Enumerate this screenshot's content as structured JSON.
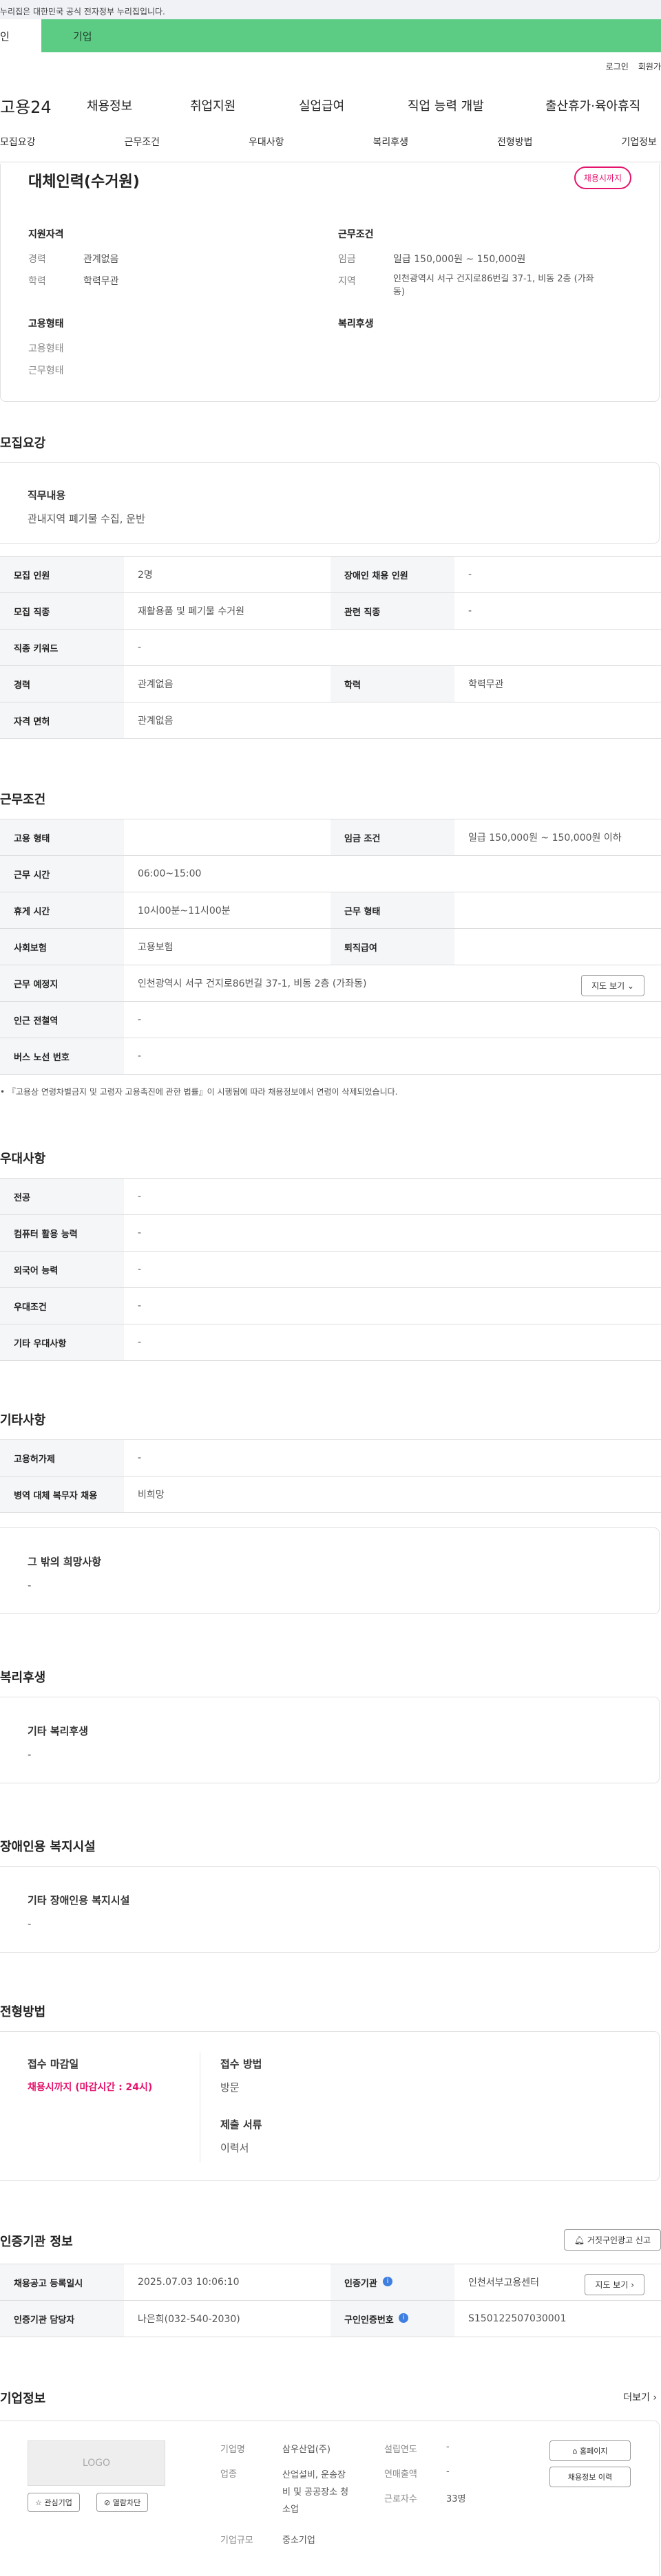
{
  "top_bar": {
    "text": "누리집은 대한민국 공식 전자정부 누리집입니다."
  },
  "seg_tabs": [
    "인",
    "기업"
  ],
  "util_nav": [
    "로그인",
    "회원가"
  ],
  "logo": "고용24",
  "main_nav": [
    "채용정보",
    "취업지원",
    "실업급여",
    "직업 능력 개발",
    "출산휴가·육아휴직"
  ],
  "tabs": [
    "모집요강",
    "근무조건",
    "우대사항",
    "복리후생",
    "전형방법",
    "기업정보"
  ],
  "summary": {
    "title": "대체인력(수거원)",
    "badge": "채용시까지",
    "qual_header": "지원자격",
    "career_label": "경력",
    "career_value": "관계없음",
    "edu_label": "학력",
    "edu_value": "학력무관",
    "work_header": "근무조건",
    "wage_label": "임금",
    "wage_value": "일급 150,000원 ~ 150,000원",
    "region_label": "지역",
    "region_value_1": "인천광역시 서구 건지로86번길 37-1, 비동 2층 (가좌",
    "region_value_2": "동)",
    "emp_header": "고용형태",
    "emp_1": "고용형태",
    "emp_2": "근무형태",
    "welfare_header": "복리후생"
  },
  "recruit": {
    "section_title": "모집요강",
    "job_header": "직무내용",
    "job_value": "관내지역 폐기물 수집, 운반",
    "rows": [
      {
        "l1": "모집 인원",
        "v1": "2명",
        "l2": "장애인 채용 인원",
        "v2": "-"
      },
      {
        "l1": "모집 직종",
        "v1": "재활용품 및 폐기물 수거원",
        "l2": "관련 직종",
        "v2": "-"
      },
      {
        "l1": "직종 키워드",
        "v1": "-"
      },
      {
        "l1": "경력",
        "v1": "관계없음",
        "l2": "학력",
        "v2": "학력무관"
      },
      {
        "l1": "자격 면허",
        "v1": "관계없음"
      }
    ]
  },
  "work": {
    "section_title": "근무조건",
    "rows": [
      {
        "l1": "고용 형태",
        "v1": "",
        "l2": "임금 조건",
        "v2": "일급 150,000원 ~ 150,000원 이하"
      },
      {
        "l1": "근무 시간",
        "v1": "06:00~15:00"
      },
      {
        "l1": "휴게 시간",
        "v1": "10시00분~11시00분",
        "l2": "근무 형태",
        "v2": ""
      },
      {
        "l1": "사회보험",
        "v1": "고용보험",
        "l2": "퇴직급여",
        "v2": ""
      },
      {
        "l1": "근무 예정지",
        "v1": "인천광역시 서구 건지로86번길 37-1, 비동 2층 (가좌동)",
        "btn": "지도 보기 ⌄"
      },
      {
        "l1": "인근 전철역",
        "v1": "-"
      },
      {
        "l1": "버스 노선 번호",
        "v1": "-"
      }
    ],
    "note": "• 『고용상 연령차별금지 및 고령자 고용촉진에 관한 법률』이 시행됨에 따라 채용정보에서 연령이 삭제되었습니다."
  },
  "pref": {
    "section_title": "우대사항",
    "rows": [
      {
        "l1": "전공",
        "v1": "-"
      },
      {
        "l1": "컴퓨터 활용 능력",
        "v1": "-"
      },
      {
        "l1": "외국어 능력",
        "v1": "-"
      },
      {
        "l1": "우대조건",
        "v1": "-"
      },
      {
        "l1": "기타 우대사항",
        "v1": "-"
      }
    ]
  },
  "etc": {
    "section_title": "기타사항",
    "rows": [
      {
        "l1": "고용허가제",
        "v1": "-"
      },
      {
        "l1": "병역 대체 복무자 채용",
        "v1": "비희망"
      }
    ],
    "box_header": "그 밖의 희망사항",
    "box_value": "-"
  },
  "welfare": {
    "section_title": "복리후생",
    "box_header": "기타 복리후생",
    "box_value": "-"
  },
  "disabled": {
    "section_title": "장애인용 복지시설",
    "box_header": "기타 장애인용 복지시설",
    "box_value": "-"
  },
  "selection": {
    "section_title": "전형방법",
    "deadline_header": "접수 마감일",
    "deadline_value": "채용시까지 (마감시간 : 24시)",
    "method_header": "접수 방법",
    "method_value": "방문",
    "docs_header": "제출 서류",
    "docs_value": "이력서"
  },
  "cert": {
    "section_title": "인증기관 정보",
    "report_btn": "거짓구인광고 신고",
    "rows": [
      {
        "l1": "채용공고 등록일시",
        "v1": "2025.07.03 10:06:10",
        "l2": "인증기관",
        "v2": "인천서부고용센터",
        "btn": "지도 보기 ›"
      },
      {
        "l1": "인증기관 담당자",
        "v1": "나은희(032-540-2030)",
        "l2": "구인인증번호",
        "v2": "S150122507030001"
      }
    ]
  },
  "company": {
    "section_title": "기업정보",
    "more": "더보기 ›",
    "logo_text": "LOGO",
    "interest_btn": "☆ 관심기업",
    "block_btn": "⊘ 열람차단",
    "name_label": "기업명",
    "name_value": "삼우산업(주)",
    "industry_label": "업종",
    "industry_value_1": "산업설비, 운송장",
    "industry_value_2": "비 및 공공장소 청",
    "industry_value_3": "소업",
    "size_label": "기업규모",
    "size_value": "중소기업",
    "founded_label": "설립연도",
    "founded_value": "-",
    "sales_label": "연매출액",
    "sales_value": "-",
    "workers_label": "근로자수",
    "workers_value": "33명",
    "homepage_btn": "홈페이지",
    "history_btn": "채용정보 이력"
  }
}
